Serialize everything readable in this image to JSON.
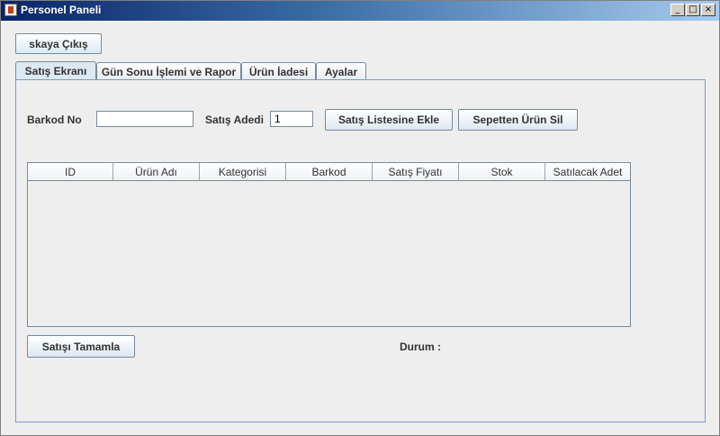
{
  "window": {
    "title": "Personel Paneli",
    "controls": {
      "minimize": "_",
      "maximize": "□",
      "close": "×"
    }
  },
  "toolbar": {
    "logout_label": "skaya Çıkış"
  },
  "tabs": [
    {
      "label": "Satış Ekranı",
      "active": true
    },
    {
      "label": "Gün Sonu İşlemi ve Rapor",
      "active": false
    },
    {
      "label": "Ürün İadesi",
      "active": false
    },
    {
      "label": "Ayalar",
      "active": false
    }
  ],
  "form": {
    "barcode_label": "Barkod No",
    "barcode_value": "",
    "quantity_label": "Satış Adedi",
    "quantity_value": "1",
    "add_button": "Satış Listesine Ekle",
    "remove_button": "Sepetten Ürün Sil"
  },
  "table": {
    "columns": [
      "ID",
      "Ürün Adı",
      "Kategorisi",
      "Barkod",
      "Satış Fiyatı",
      "Stok",
      "Satılacak Adet"
    ],
    "rows": []
  },
  "footer": {
    "complete_button": "Satışı Tamamla",
    "status_label": "Durum :"
  },
  "colors": {
    "title_start": "#0a246a",
    "title_end": "#a6caf0",
    "panel_border": "#7a9cc5"
  }
}
